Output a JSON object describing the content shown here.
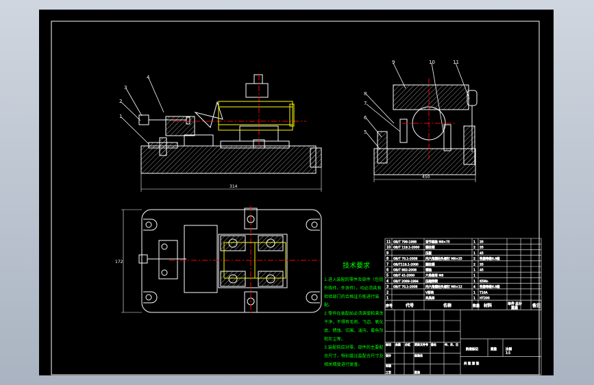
{
  "drawing": {
    "balloon_labels_front": [
      "1",
      "2",
      "3",
      "4"
    ],
    "balloon_labels_side": [
      "9",
      "10",
      "11",
      "8",
      "7",
      "6",
      "5"
    ],
    "dim_front_width": "314",
    "dim_side_width": "450",
    "dim_top_height": "172"
  },
  "tech_requirements": {
    "title": "技术要求",
    "lines": [
      "1.进入装配的零件及部件（包括",
      "外购件、外协件），均必须具有",
      "检验部门的合格证方能进行装",
      "配。",
      "2.零件在装配前必须清理和清洗",
      "干净，不得有毛刺、飞边、氧化",
      "皮、锈蚀、切屑、油污、着色剂",
      "和灰尘等。",
      "3.装配前应对零、部件的主要配",
      "合尺寸，特别是过盈配合尺寸及",
      "相关精度进行复查。"
    ]
  },
  "bom": {
    "rows": [
      {
        "no": "11",
        "code": "GB/T 798-1988",
        "name": "活节螺栓 M8×75",
        "qty": "1",
        "mat": "35"
      },
      {
        "no": "10",
        "code": "GB/T 119.1-2000",
        "name": "圆柱销",
        "qty": "2",
        "mat": "35"
      },
      {
        "no": "9",
        "code": "",
        "name": "压板",
        "qty": "1",
        "mat": "45"
      },
      {
        "no": "8",
        "code": "GB/T 70.1-2008",
        "name": "内六角圆柱头螺钉 M8×25",
        "qty": "2",
        "mat": "性能等级8.8级"
      },
      {
        "no": "7",
        "code": "GB/T119.1-2000",
        "name": "圆柱销",
        "qty": "2",
        "mat": "35"
      },
      {
        "no": "6",
        "code": "GB/T 882-2008",
        "name": "销轴",
        "qty": "1",
        "mat": "45"
      },
      {
        "no": "5",
        "code": "GB/T 41-2000",
        "name": "六角螺母 M8",
        "qty": "1",
        "mat": ""
      },
      {
        "no": "4",
        "code": "GB/T 2089-1994",
        "name": "压缩弹簧",
        "qty": "1",
        "mat": "65Mn"
      },
      {
        "no": "3",
        "code": "GB/T 70.1-2008",
        "name": "内六角圆柱头螺钉 M6×12",
        "qty": "4",
        "mat": "性能等级8.8级"
      },
      {
        "no": "2",
        "code": "",
        "name": "V形块",
        "qty": "1",
        "mat": "T10A"
      },
      {
        "no": "1",
        "code": "",
        "name": "夹具体",
        "qty": "1",
        "mat": "HT200"
      }
    ],
    "header": {
      "no": "序号",
      "code": "代号",
      "name": "名称",
      "qty": "数量",
      "mat": "材料",
      "w1": "单件",
      "w2": "总计",
      "w": "重量",
      "note": "备注"
    }
  },
  "title_block": {
    "labels": [
      "标记",
      "处数",
      "分区",
      "更改文件号",
      "签名",
      "年、月、日",
      "设计",
      "标准化",
      "审核",
      "工艺",
      "批准"
    ],
    "stage": "阶段标记",
    "weight": "重量",
    "scale": "比例",
    "scale_value": "1:1",
    "sheet": "共  张  第  张"
  },
  "colors": {
    "line": "#ffffff",
    "green": "#00ff00",
    "red": "#ff0000",
    "yellow": "#ffff00",
    "frame": "#ffffff"
  }
}
